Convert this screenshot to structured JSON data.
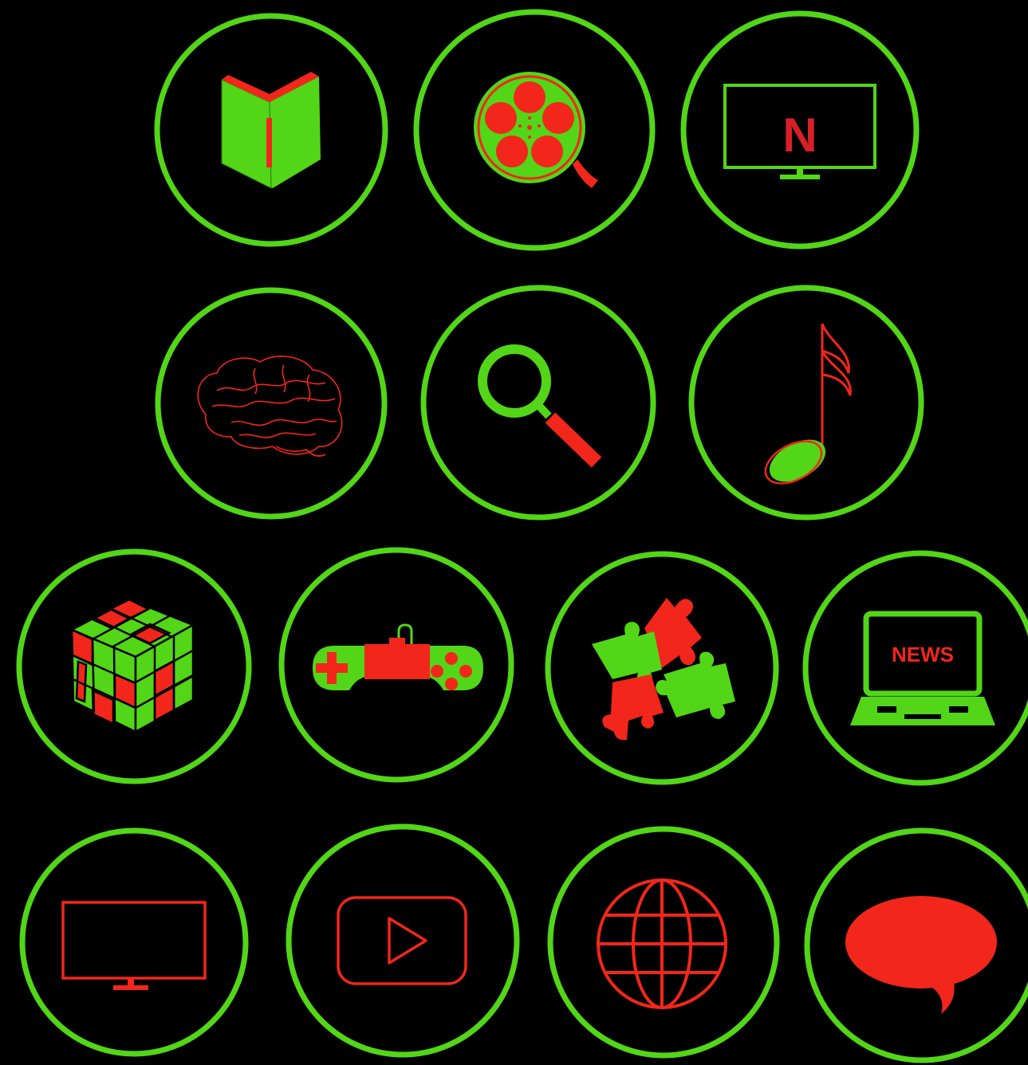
{
  "colors": {
    "background": "#000000",
    "green": "#52d617",
    "red": "#f2261b",
    "netflix_red": "#d81f26"
  },
  "icons": [
    {
      "name": "book-icon"
    },
    {
      "name": "film-reel-icon"
    },
    {
      "name": "netflix-tv-icon",
      "label": "N"
    },
    {
      "name": "brain-icon"
    },
    {
      "name": "magnifying-glass-icon"
    },
    {
      "name": "music-note-icon"
    },
    {
      "name": "rubiks-cube-icon"
    },
    {
      "name": "game-controller-icon"
    },
    {
      "name": "puzzle-pieces-icon"
    },
    {
      "name": "news-laptop-icon",
      "label": "NEWS"
    },
    {
      "name": "television-icon"
    },
    {
      "name": "youtube-play-icon"
    },
    {
      "name": "globe-icon"
    },
    {
      "name": "speech-bubble-icon"
    }
  ]
}
